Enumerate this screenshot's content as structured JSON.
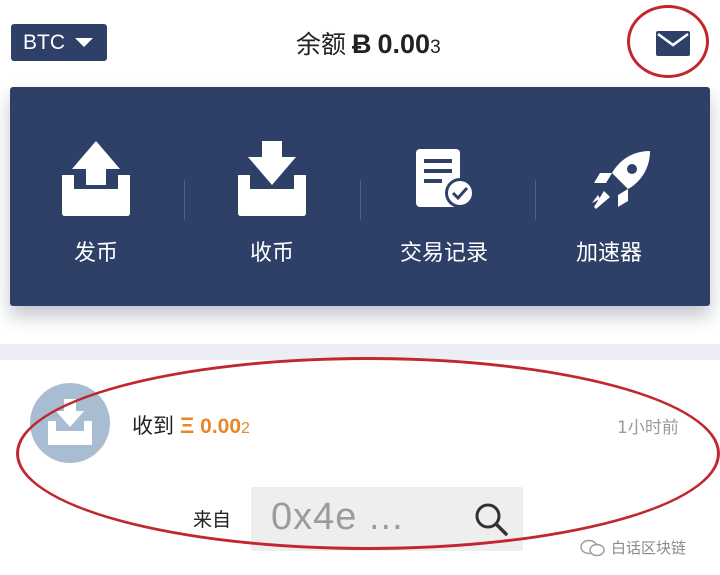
{
  "header": {
    "coin_selector": "BTC",
    "balance_label": "余额",
    "balance_symbol": "Ƀ",
    "balance_amount": "0.00",
    "balance_amount_tail": "3"
  },
  "actions": [
    {
      "label": "发币",
      "icon": "send-tray-icon"
    },
    {
      "label": "收币",
      "icon": "receive-tray-icon"
    },
    {
      "label": "交易记录",
      "icon": "transaction-record-icon"
    },
    {
      "label": "加速器",
      "icon": "rocket-icon"
    }
  ],
  "transaction": {
    "title_prefix": "收到",
    "currency_symbol": "Ξ",
    "amount": "0.00",
    "amount_tail": "2",
    "time": "1小时前",
    "from_label": "来自",
    "from_address": "0x4e ..."
  },
  "watermark": {
    "text": "白话区块链"
  },
  "colors": {
    "primary": "#2e3f68",
    "accent_orange": "#e8862a",
    "annotation_red": "#c1272d"
  }
}
